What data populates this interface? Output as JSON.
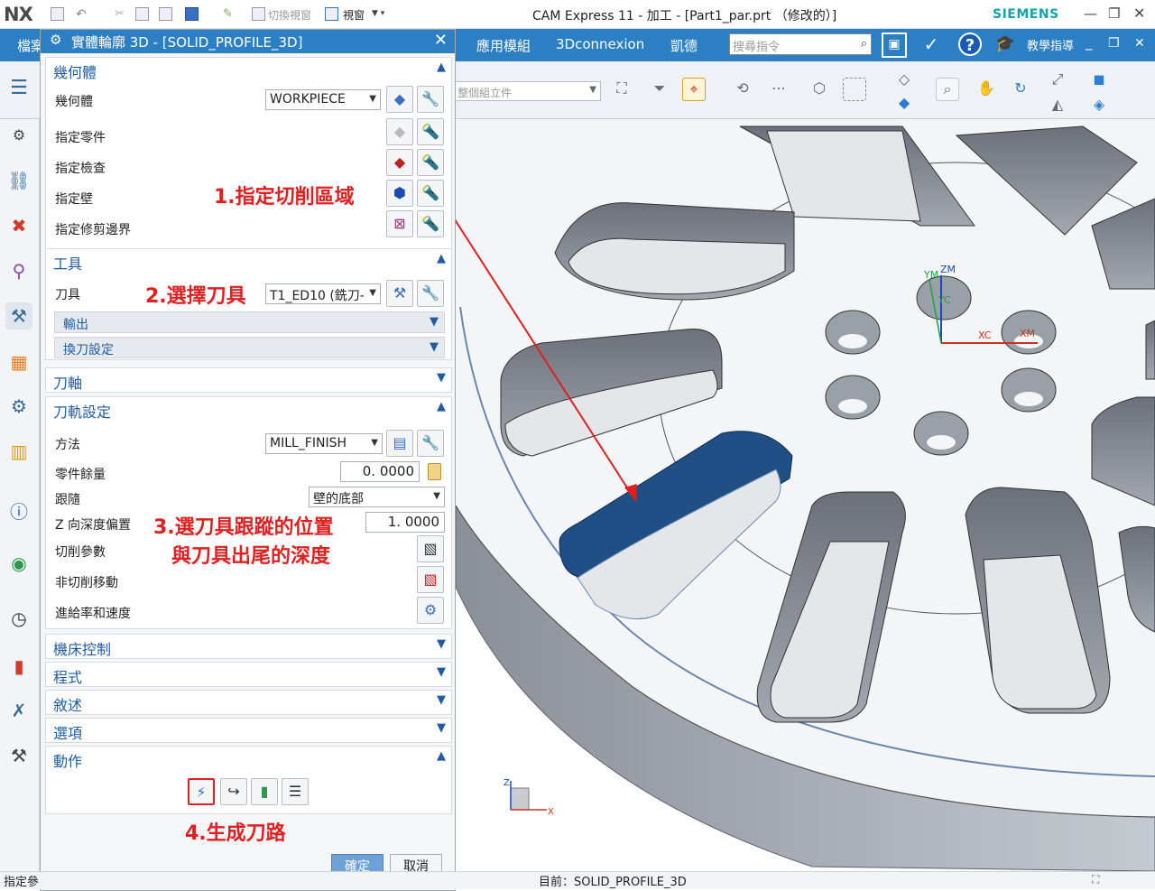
{
  "app": {
    "logo": "NX",
    "window_title": "CAM Express 11 - 加工 - [Part1_par.prt （修改的）]",
    "brand": "SIEMENS",
    "quick_access": {
      "switch_view": "切換視窗",
      "window": "視窗"
    }
  },
  "menu": {
    "file": "檔案",
    "app_module": "應用模組",
    "connexion": "3Dconnexion",
    "kaide": "凱德",
    "search_placeholder": "搜尋指令",
    "guide": "教學指導"
  },
  "toolbar": {
    "filter": "整個組立件"
  },
  "dialog": {
    "title": "實體輪廓 3D - [SOLID_PROFILE_3D]",
    "sections": {
      "geometry": {
        "title": "幾何體",
        "geometry_label": "幾何體",
        "geometry_value": "WORKPIECE",
        "part_label": "指定零件",
        "check_label": "指定檢查",
        "wall_label": "指定壁",
        "trim_label": "指定修剪邊界"
      },
      "tool": {
        "title": "工具",
        "tool_label": "刀具",
        "tool_value": "T1_ED10 (銑刀-",
        "output": "輸出",
        "tool_change": "換刀設定"
      },
      "axis": {
        "title": "刀軸"
      },
      "path": {
        "title": "刀軌設定",
        "method_label": "方法",
        "method_value": "MILL_FINISH",
        "stock_label": "零件餘量",
        "stock_value": "0. 0000",
        "follow_label": "跟隨",
        "follow_value": "壁的底部",
        "zoffset_label": "Z 向深度偏置",
        "zoffset_value": "1. 0000",
        "cut_params": "切削參數",
        "non_cut": "非切削移動",
        "feeds": "進給率和速度"
      },
      "machine": {
        "title": "機床控制"
      },
      "program": {
        "title": "程式"
      },
      "description": {
        "title": "敘述"
      },
      "options": {
        "title": "選項"
      },
      "actions": {
        "title": "動作"
      }
    },
    "ok": "確定",
    "cancel": "取消"
  },
  "annotations": {
    "a1": "1.指定切削區域",
    "a2": "2.選擇刀具",
    "a3_line1": "3.選刀具跟蹤的位置",
    "a3_line2": "與刀具出尾的深度",
    "a4": "4.生成刀路"
  },
  "viewport": {
    "axis_labels": {
      "xc": "XC",
      "ym": "YM",
      "zm": "ZM",
      "xm": "XM",
      "yc": "YC"
    },
    "triad": {
      "z": "Z",
      "x": "X"
    }
  },
  "statusbar": {
    "left": "指定參",
    "current": "目前：SOLID_PROFILE_3D"
  },
  "colors": {
    "menu_blue": "#2d7fc3",
    "section_blue": "#1f5da0",
    "annotation_red": "#e02020",
    "highlight_wall": "#1f4f85",
    "brand": "#15a3a4"
  }
}
